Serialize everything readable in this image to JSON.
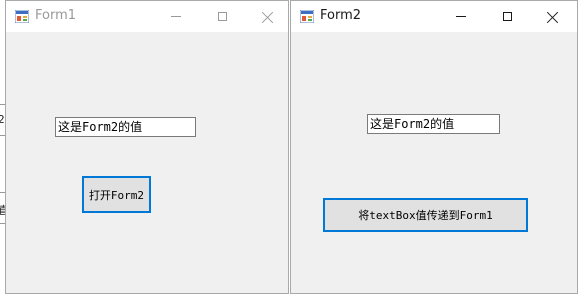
{
  "form1": {
    "title": "Form1",
    "textbox_value": "这是Form2的值",
    "open_button_label": "打开Form2"
  },
  "form2": {
    "title": "Form2",
    "textbox_value": "这是Form2的值",
    "pass_button_label": "将textBox值传递到Form1"
  },
  "background_window": {
    "partial_glyph_top": "2",
    "partial_glyph_bottom": "直"
  },
  "colors": {
    "window_body": "#f0f0f0",
    "titlebar": "#ffffff",
    "button_face": "#e1e1e1",
    "button_focus_border": "#0078d7",
    "inactive_title": "#999999"
  },
  "icons": {
    "app_icon": "winforms-app-icon",
    "minimize": "minimize-icon",
    "maximize": "maximize-icon",
    "close": "close-icon"
  }
}
